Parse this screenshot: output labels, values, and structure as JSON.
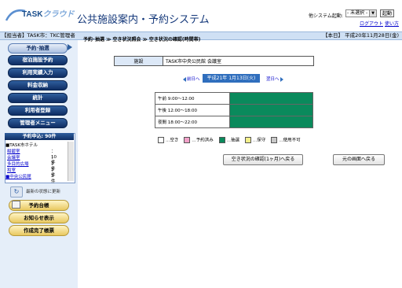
{
  "header": {
    "logo_text_a": "TASK",
    "logo_text_b": "クラウド",
    "title": "公共施設案内・予約システム",
    "other_system_label": "他システム起動:",
    "other_system_selected": "- 未選択 -",
    "launch_button": "起動",
    "logout_link": "ログアウト",
    "help_link": "使い方"
  },
  "topbar": {
    "user": "【担当者】TASK市：TKC管理者",
    "today": "【本日】 平成20年11月28日(金)"
  },
  "sidebar": {
    "nav": [
      {
        "label": "予約･抽選",
        "active": true
      },
      {
        "label": "宿泊施設予約"
      },
      {
        "label": "利用実績入力"
      },
      {
        "label": "料金収納"
      },
      {
        "label": "統計"
      },
      {
        "label": "利用者登録"
      },
      {
        "label": "管理者メニュー"
      }
    ],
    "reservations": {
      "header": "予約申込: 90件",
      "group": "■TASK市ホテル",
      "rows": [
        {
          "name": "紺碧室",
          "count": "：10件"
        },
        {
          "name": "会議室",
          "count": "：3件"
        },
        {
          "name": "多目的広場",
          "count": "：3件"
        },
        {
          "name": "和室",
          "count": "：3件"
        },
        {
          "name": "■中央公民館",
          "count": ""
        }
      ]
    },
    "update_label": "最新の状態に更新",
    "bottom_buttons": [
      "予約台帳",
      "お知らせ表示",
      "作成完了帳票"
    ]
  },
  "main": {
    "breadcrumb": "予約･抽選 ≫ 空き状況照会 ≫ 空き状況の確認(時間帯)",
    "facility": {
      "header": "施設",
      "value": "TASK市中央公民館 会議室"
    },
    "date_nav": {
      "prev": "前日へ",
      "date": "平成21年 1月13日(火)",
      "next": "翌日へ"
    },
    "slots": [
      {
        "label": "午前  9:00〜12:00",
        "status": "抽選"
      },
      {
        "label": "午後  12:00〜18:00",
        "status": "抽選"
      },
      {
        "label": "夜間  18:00〜22:00",
        "status": "抽選"
      }
    ],
    "legend": [
      {
        "label": "…空き",
        "color": "#ffffff"
      },
      {
        "label": "…予約済み",
        "color": "#f2a0c8"
      },
      {
        "label": "…抽選",
        "color": "#0a8a5c"
      },
      {
        "label": "…保守",
        "color": "#f4f08a"
      },
      {
        "label": "…使用不可",
        "color": "#c8c8c8"
      }
    ],
    "back_month_button": "空き状況の確認(1ヶ月)へ戻る",
    "back_screen_button": "元の画面へ戻る"
  }
}
